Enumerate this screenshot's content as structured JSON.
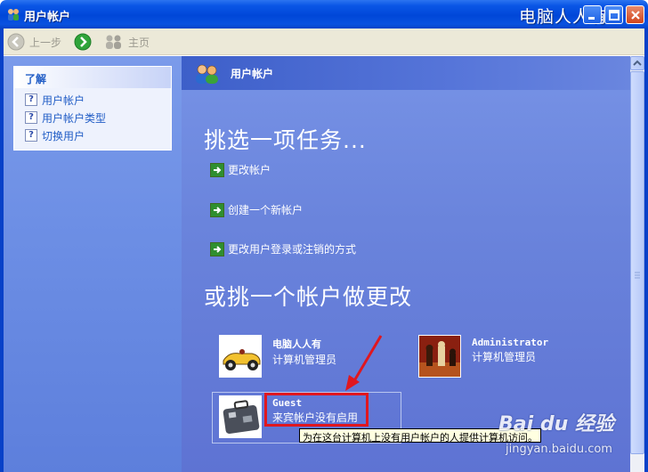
{
  "window": {
    "title": "用户帐户",
    "watermark": "电脑人人有"
  },
  "toolbar": {
    "back": "上一步",
    "home": "主页"
  },
  "sidebar": {
    "heading": "了解",
    "items": [
      {
        "label": "用户帐户"
      },
      {
        "label": "用户帐户类型"
      },
      {
        "label": "切换用户"
      }
    ]
  },
  "main": {
    "header_title": "用户帐户",
    "task_heading": "挑选一项任务...",
    "tasks": [
      {
        "label": "更改帐户"
      },
      {
        "label": "创建一个新帐户"
      },
      {
        "label": "更改用户登录或注销的方式"
      }
    ],
    "account_heading": "或挑一个帐户做更改",
    "accounts": [
      {
        "name": "电脑人人有",
        "role": "计算机管理员"
      },
      {
        "name": "Administrator",
        "role": "计算机管理员"
      },
      {
        "name": "Guest",
        "role": "来宾帐户没有启用"
      }
    ]
  },
  "tooltip": "为在这台计算机上没有用户帐户的人提供计算机访问。",
  "watermark_site": {
    "logo": "Bai du 经验",
    "url": "jingyan.baidu.com"
  },
  "colors": {
    "title_blue": "#0047d8",
    "pane_blue": "#6a84dc",
    "link_blue": "#215dc6",
    "highlight_red": "#e0171f",
    "tooltip_bg": "#ffffe1"
  }
}
